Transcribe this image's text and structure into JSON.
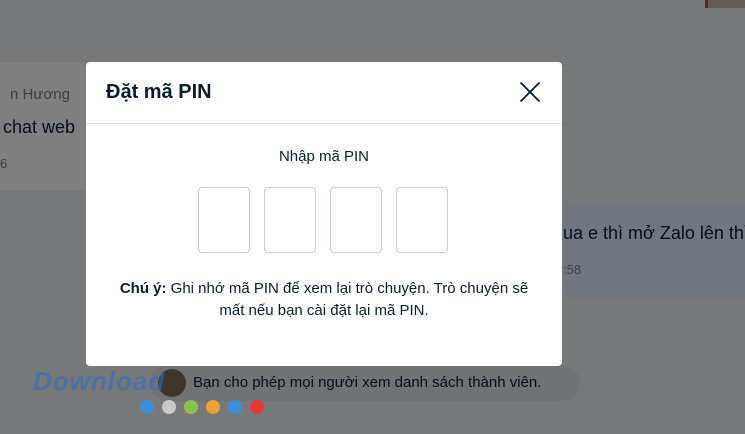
{
  "background": {
    "left_bubble": {
      "sender": "n Hương",
      "text": "chat web",
      "time": "6"
    },
    "right_bubble": {
      "text": "ua e thì mở Zalo lên thì",
      "time": ":58"
    },
    "notice": {
      "text": "Bạn cho phép mọi người xem danh sách thành viên."
    }
  },
  "modal": {
    "title": "Đặt mã PIN",
    "close_icon": "close-icon",
    "pin_label": "Nhập mã PIN",
    "pin_boxes": [
      "",
      "",
      "",
      ""
    ],
    "note_label": "Chú ý:",
    "note_text": " Ghi nhớ mã PIN để xem lại trò chuyện. Trò chuyện sẽ mất nếu bạn cài đặt lại mã PIN."
  },
  "watermark": {
    "text": "Download",
    "dot_colors": [
      "#3a8fd8",
      "#c9c9c9",
      "#8bc34a",
      "#f0a030",
      "#3a8fd8",
      "#e53935"
    ]
  },
  "colors": {
    "text": "#081c36",
    "border": "#c7ccd4",
    "overlay": "rgba(0,0,0,0.5)"
  }
}
